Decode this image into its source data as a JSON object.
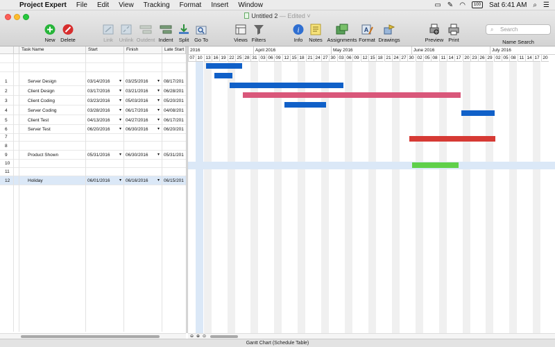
{
  "menubar": {
    "app_name": "Project Expert",
    "items": [
      "File",
      "Edit",
      "View",
      "Tracking",
      "Format",
      "Insert",
      "Window"
    ],
    "battery": "100",
    "clock": "Sat 6:41 AM"
  },
  "window": {
    "title": "Untitled 2",
    "title_state": "— Edited ˅"
  },
  "toolbar": {
    "new": "New",
    "delete": "Delete",
    "link": "Link",
    "unlink": "Unlink",
    "outdent": "Outdent",
    "indent": "Indent",
    "split": "Split",
    "goto": "Go To",
    "views": "Views",
    "filters": "Filters",
    "info": "Info",
    "notes": "Notes",
    "assignments": "Assignments",
    "format": "Format",
    "drawings": "Drawings",
    "preview": "Preview",
    "print": "Print",
    "search_placeholder": "Search",
    "name_search": "Name Search"
  },
  "table": {
    "headers": {
      "task_name": "Task Name",
      "start": "Start",
      "finish": "Finish",
      "late_start": "Late Start"
    },
    "rows": [
      {
        "num": "",
        "name": "",
        "start": "",
        "finish": "",
        "late": ""
      },
      {
        "num": "",
        "name": "",
        "start": "",
        "finish": "",
        "late": ""
      },
      {
        "num": "1",
        "name": "Server Design",
        "start": "03/14/2016",
        "finish": "03/25/2016",
        "late": "08/17/201"
      },
      {
        "num": "2",
        "name": "Client Design",
        "start": "03/17/2016",
        "finish": "03/21/2016",
        "late": "06/28/201"
      },
      {
        "num": "3",
        "name": "Client Coding",
        "start": "03/23/2016",
        "finish": "05/03/2016",
        "late": "05/20/201"
      },
      {
        "num": "4",
        "name": "Server Coding",
        "start": "03/28/2016",
        "finish": "06/17/2016",
        "late": "04/08/201"
      },
      {
        "num": "5",
        "name": "Client Test",
        "start": "04/13/2016",
        "finish": "04/27/2016",
        "late": "06/17/201"
      },
      {
        "num": "6",
        "name": "Server Test",
        "start": "06/20/2016",
        "finish": "06/30/2016",
        "late": "06/20/201"
      },
      {
        "num": "7",
        "name": "",
        "start": "",
        "finish": "",
        "late": ""
      },
      {
        "num": "8",
        "name": "",
        "start": "",
        "finish": "",
        "late": ""
      },
      {
        "num": "9",
        "name": "Product Shown",
        "start": "05/31/2016",
        "finish": "06/30/2016",
        "late": "05/31/201"
      },
      {
        "num": "10",
        "name": "",
        "start": "",
        "finish": "",
        "late": ""
      },
      {
        "num": "11",
        "name": "",
        "start": "",
        "finish": "",
        "late": ""
      },
      {
        "num": "12",
        "name": "Holiday",
        "start": "06/01/2016",
        "finish": "06/16/2016",
        "late": "06/15/201"
      }
    ],
    "selected_row": "12"
  },
  "gantt": {
    "months": [
      "2016",
      "April 2016",
      "May 2016",
      "June 2016",
      "July 2016"
    ],
    "week_labels": [
      "07",
      "10",
      "13",
      "16",
      "19",
      "22",
      "25",
      "28",
      "31",
      "03",
      "06",
      "09",
      "12",
      "15",
      "18",
      "21",
      "24",
      "27",
      "30",
      "03",
      "06",
      "09",
      "12",
      "15",
      "18",
      "21",
      "24",
      "27",
      "30",
      "02",
      "05",
      "08",
      "11",
      "14",
      "17",
      "20",
      "23",
      "26",
      "29",
      "02",
      "05",
      "08",
      "11",
      "14",
      "17",
      "20"
    ],
    "colors": {
      "blue": "#1060c8",
      "pink": "#d9577a",
      "red": "#d63a34",
      "green": "#5fd04a",
      "stripe": "#f0f0f0",
      "selection": "#dbe8f7"
    }
  },
  "status_bar": "Gantt Chart (Schedule Table)"
}
